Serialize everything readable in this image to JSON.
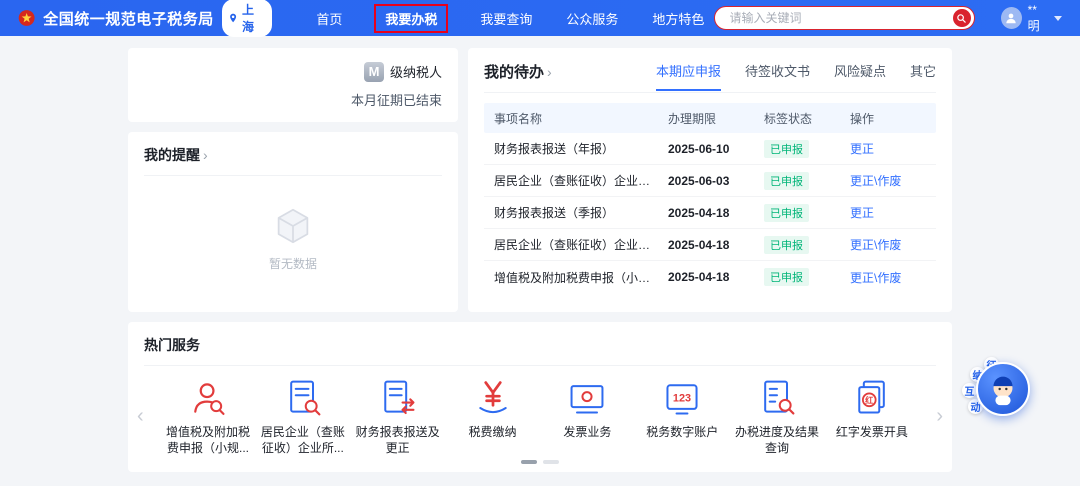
{
  "header": {
    "title": "全国统一规范电子税务局",
    "location": "上海",
    "nav": [
      {
        "label": "首页"
      },
      {
        "label": "我要办税",
        "highlighted": true
      },
      {
        "label": "我要查询"
      },
      {
        "label": "公众服务"
      },
      {
        "label": "地方特色"
      }
    ],
    "search": {
      "placeholder": "请输入关键词"
    },
    "user": {
      "name": "**明"
    }
  },
  "taxpayer": {
    "level": "M",
    "level_label": "级纳税人",
    "period_status": "本月征期已结束"
  },
  "reminders": {
    "title": "我的提醒",
    "empty_text": "暂无数据"
  },
  "todo": {
    "title": "我的待办",
    "tabs": [
      {
        "label": "本期应申报",
        "active": true
      },
      {
        "label": "待签收文书"
      },
      {
        "label": "风险疑点"
      },
      {
        "label": "其它"
      }
    ],
    "columns": [
      "事项名称",
      "办理期限",
      "标签状态",
      "操作"
    ],
    "rows": [
      {
        "name": "财务报表报送（年报）",
        "deadline": "2025-06-10",
        "status": "已申报",
        "action": "更正"
      },
      {
        "name": "居民企业（查账征收）企业所得税年度...",
        "deadline": "2025-06-03",
        "status": "已申报",
        "action": "更正\\作废"
      },
      {
        "name": "财务报表报送（季报）",
        "deadline": "2025-04-18",
        "status": "已申报",
        "action": "更正"
      },
      {
        "name": "居民企业（查账征收）企业所得税月（...",
        "deadline": "2025-04-18",
        "status": "已申报",
        "action": "更正\\作废"
      },
      {
        "name": "增值税及附加税费申报（小规模纳税人）",
        "deadline": "2025-04-18",
        "status": "已申报",
        "action": "更正\\作废"
      }
    ]
  },
  "hot_services": {
    "title": "热门服务",
    "items": [
      {
        "label": "增值税及附加税费申报（小规..."
      },
      {
        "label": "居民企业（查账征收）企业所..."
      },
      {
        "label": "财务报表报送及更正"
      },
      {
        "label": "税费缴纳"
      },
      {
        "label": "发票业务"
      },
      {
        "label": "税务数字账户"
      },
      {
        "label": "办税进度及结果查询"
      },
      {
        "label": "红字发票开具"
      }
    ]
  },
  "assistant_widget": {
    "chars": [
      "征",
      "纳",
      "互",
      "动"
    ]
  },
  "colors": {
    "header_blue": "#2a66f0",
    "link_blue": "#3370ff",
    "accent_red": "#d9232e",
    "status_green": "#00b578",
    "highlight_box_red": "#e8001c"
  }
}
